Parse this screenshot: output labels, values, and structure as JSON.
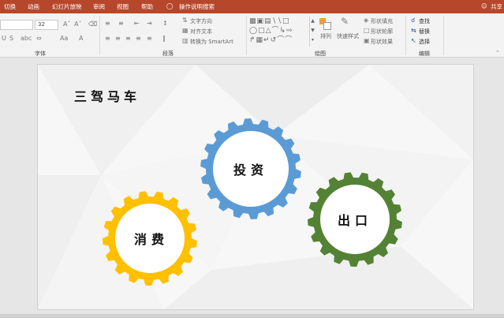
{
  "tabs": [
    "切换",
    "动画",
    "幻灯片放映",
    "审阅",
    "视图",
    "帮助",
    "操作说明搜索"
  ],
  "share": "共享",
  "font": {
    "size": "32"
  },
  "groups": {
    "font": "字体",
    "paragraph": "段落",
    "drawing": "绘图",
    "editing": "编辑"
  },
  "paragraph": {
    "text_direction": "文字方向",
    "align_text": "对齐文本",
    "smartart": "转换为 SmartArt"
  },
  "drawing": {
    "arrange": "排列",
    "quick_styles": "快速样式",
    "shape_fill": "形状填充",
    "shape_outline": "形状轮廓",
    "shape_effects": "形状效果"
  },
  "editing": {
    "find": "查找",
    "replace": "替换",
    "select": "选择"
  },
  "slide": {
    "title": "三驾马车",
    "gears": [
      {
        "label": "投资",
        "color": "#5b9bd5"
      },
      {
        "label": "消费",
        "color": "#ffc000"
      },
      {
        "label": "出口",
        "color": "#548235"
      }
    ]
  }
}
